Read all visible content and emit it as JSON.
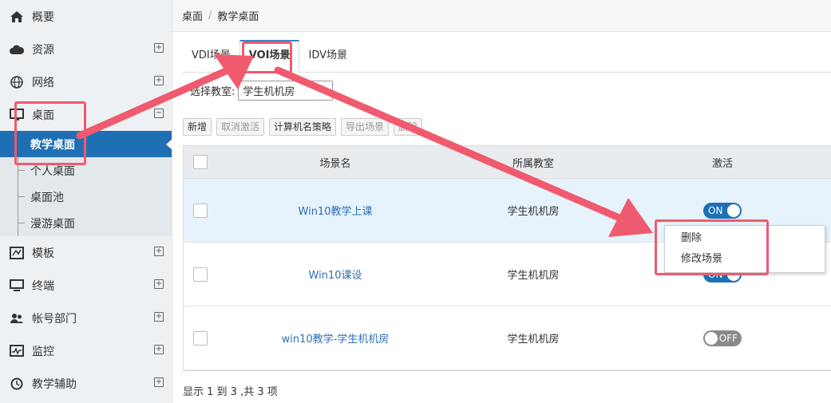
{
  "breadcrumb": {
    "root": "桌面",
    "separator": "/",
    "current": "教学桌面"
  },
  "sidebar": {
    "items": [
      {
        "label": "概要",
        "icon": "home-icon",
        "expand": ""
      },
      {
        "label": "资源",
        "icon": "cloud-icon",
        "expand": "⊞"
      },
      {
        "label": "网络",
        "icon": "globe-icon",
        "expand": "⊞"
      },
      {
        "label": "桌面",
        "icon": "monitor-icon",
        "expand": "⊟"
      }
    ],
    "desktop_sub": [
      {
        "label": "教学桌面",
        "active": true
      },
      {
        "label": "个人桌面"
      },
      {
        "label": "桌面池"
      },
      {
        "label": "漫游桌面"
      }
    ],
    "items_after": [
      {
        "label": "模板",
        "icon": "template-icon",
        "expand": "⊞"
      },
      {
        "label": "终端",
        "icon": "terminal-icon",
        "expand": "⊞"
      },
      {
        "label": "帐号部门",
        "icon": "users-icon",
        "expand": "⊞"
      },
      {
        "label": "监控",
        "icon": "monitor-chart-icon",
        "expand": "⊞"
      },
      {
        "label": "教学辅助",
        "icon": "clock-icon",
        "expand": "⊞"
      }
    ]
  },
  "tabs": [
    {
      "label": "VDI场景"
    },
    {
      "label": "VOI场景",
      "active": true
    },
    {
      "label": "IDV场景"
    }
  ],
  "room_select": {
    "label": "选择教室:",
    "value": "学生机机房"
  },
  "toolbar": [
    "新增",
    "取消激活",
    "计算机名策略",
    "导出场景",
    "删除"
  ],
  "table": {
    "headers": {
      "name": "场景名",
      "room": "所属教室",
      "active": "激活"
    },
    "rows": [
      {
        "name": "Win10教学上课",
        "room": "学生机机房",
        "active": "ON"
      },
      {
        "name": "Win10课设",
        "room": "学生机机房",
        "active": "ON"
      },
      {
        "name": "win10教学-学生机机房",
        "room": "学生机机房",
        "active": "OFF"
      }
    ]
  },
  "footer": "显示 1 到 3 ,共 3 项",
  "context_menu": [
    "删除",
    "修改场景"
  ],
  "colors": {
    "accent": "#1f6fb5",
    "annotation": "#f05a6e"
  }
}
